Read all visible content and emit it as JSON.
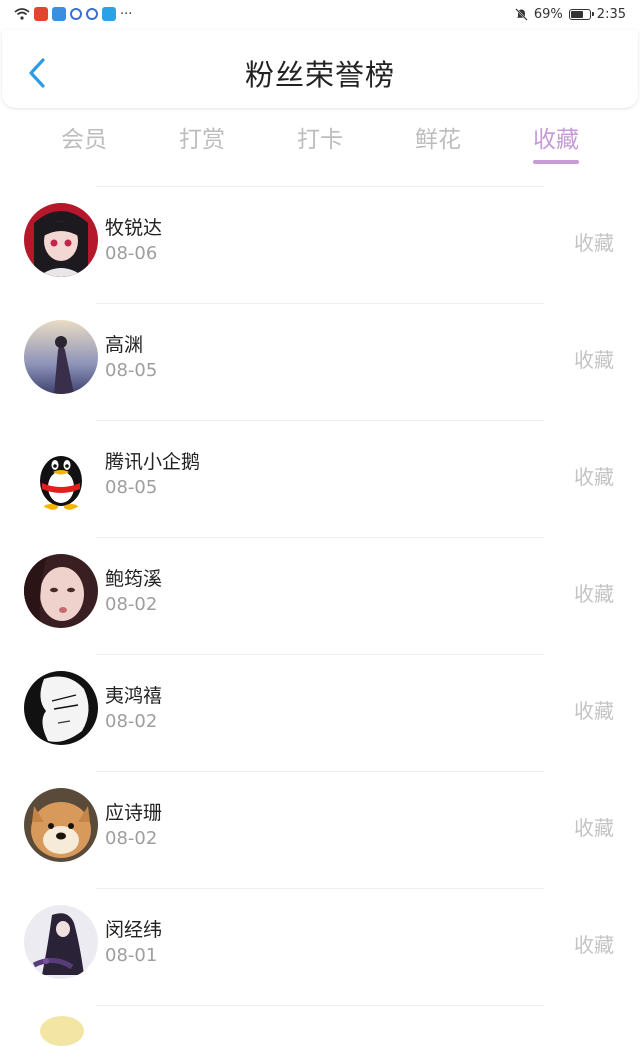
{
  "status_bar": {
    "battery_text": "69%",
    "battery_level": 0.69,
    "time": "2:35",
    "more": "···"
  },
  "header": {
    "title": "粉丝荣誉榜"
  },
  "colors": {
    "accent": "#c79ad8",
    "back": "#2e9be6",
    "tab_inactive": "#bdbdbd",
    "muted": "#9e9e9e"
  },
  "tabs": [
    {
      "label": "会员",
      "active": false
    },
    {
      "label": "打赏",
      "active": false
    },
    {
      "label": "打卡",
      "active": false
    },
    {
      "label": "鲜花",
      "active": false
    },
    {
      "label": "收藏",
      "active": true
    }
  ],
  "fans": [
    {
      "name": "牧锐达",
      "date": "08-06",
      "action": "收藏"
    },
    {
      "name": "高渊",
      "date": "08-05",
      "action": "收藏"
    },
    {
      "name": "腾讯小企鹅",
      "date": "08-05",
      "action": "收藏"
    },
    {
      "name": "鲍筠溪",
      "date": "08-02",
      "action": "收藏"
    },
    {
      "name": "夷鸿禧",
      "date": "08-02",
      "action": "收藏"
    },
    {
      "name": "应诗珊",
      "date": "08-02",
      "action": "收藏"
    },
    {
      "name": "闵经纬",
      "date": "08-01",
      "action": "收藏"
    }
  ]
}
